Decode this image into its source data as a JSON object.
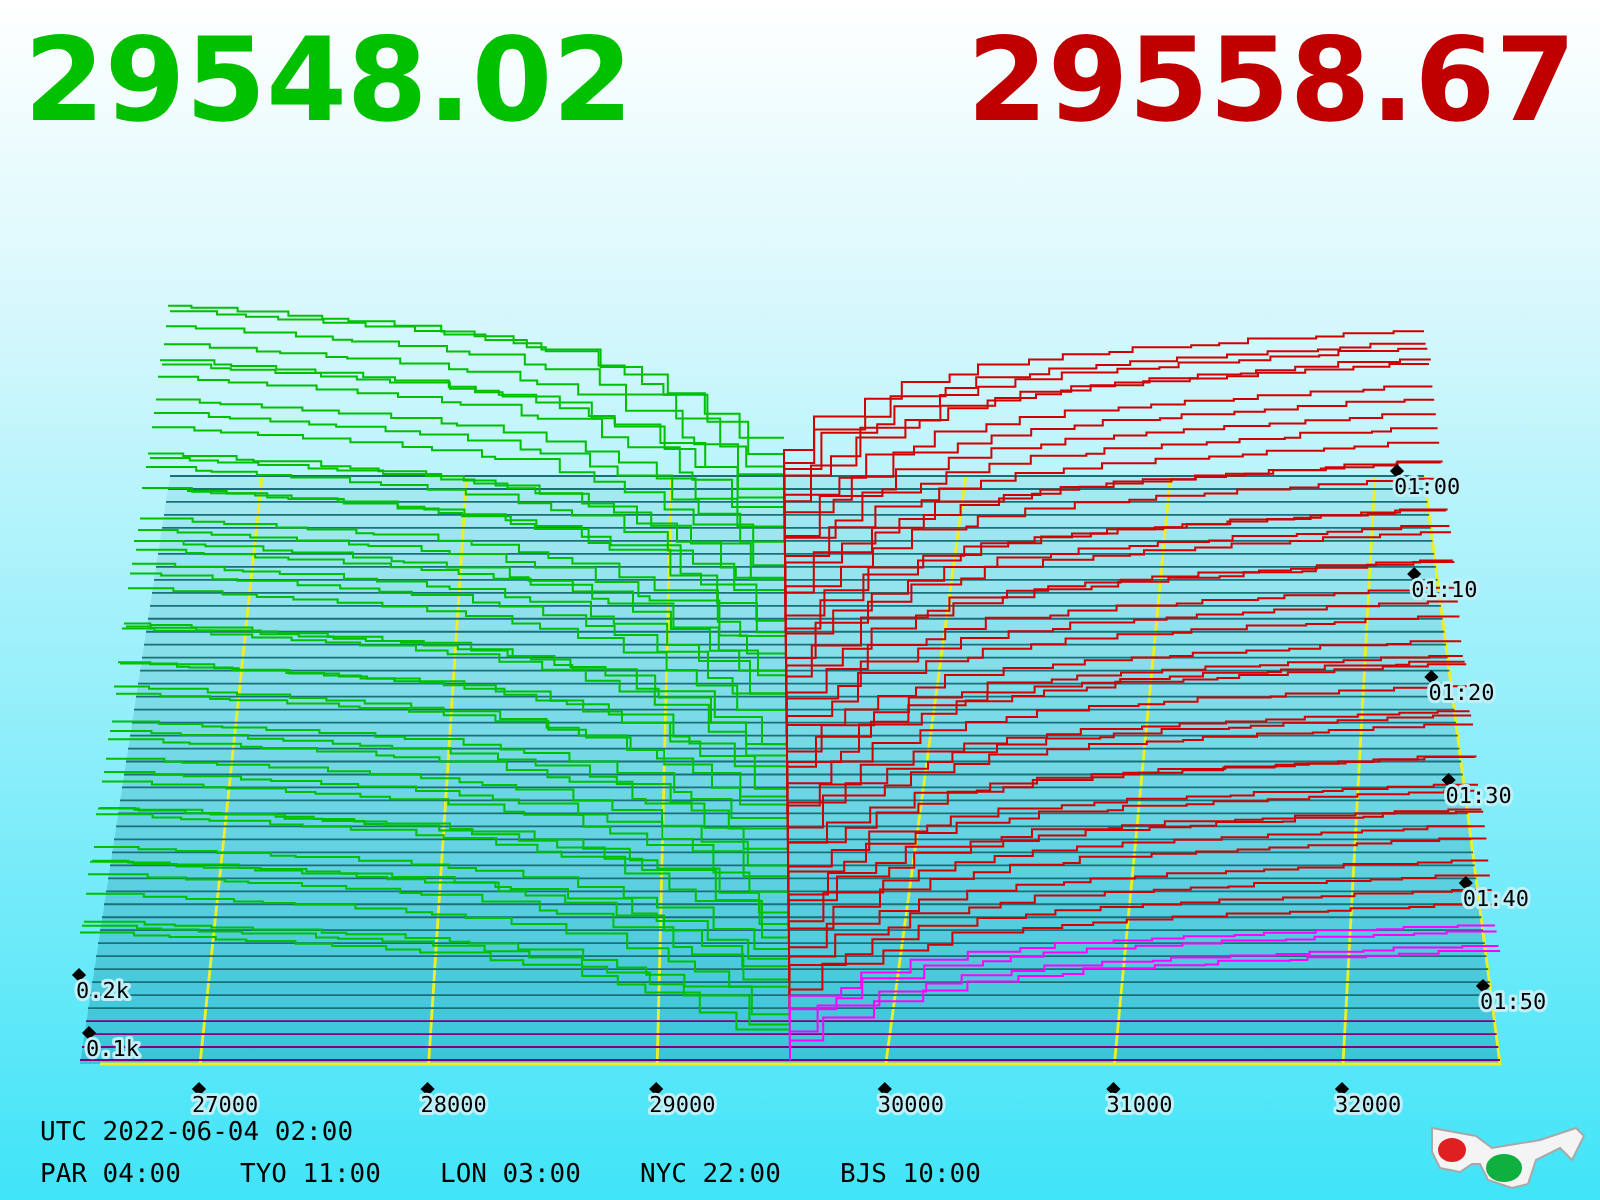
{
  "bid_price": "29548.02",
  "ask_price": "29558.67",
  "price_axis": [
    "27000",
    "28000",
    "29000",
    "30000",
    "31000",
    "32000"
  ],
  "time_axis": [
    "01:00",
    "01:10",
    "01:20",
    "01:30",
    "01:40",
    "01:50"
  ],
  "volume_axis": [
    "0.2k",
    "0.1k"
  ],
  "utc_time": "UTC 2022-06-04 02:00",
  "city_times": [
    "PAR 04:00",
    "TYO 11:00",
    "LON 03:00",
    "NYC 22:00",
    "BJS 10:00"
  ]
}
